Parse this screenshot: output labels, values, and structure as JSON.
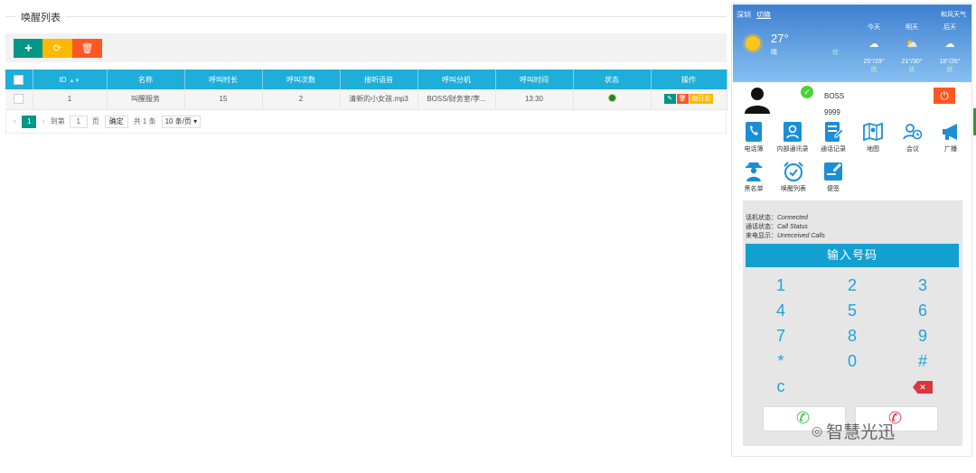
{
  "page": {
    "title": "唤醒列表"
  },
  "toolbar": {
    "add_icon": "+",
    "refresh_icon": "⟳",
    "delete_icon": "🗑"
  },
  "table": {
    "columns": [
      "ID",
      "名称",
      "呼叫时长",
      "呼叫次数",
      "接听语音",
      "呼叫分机",
      "呼叫时间",
      "状态",
      "操作"
    ],
    "rows": [
      {
        "id": "1",
        "name": "叫醒服务",
        "duration": "15",
        "count": "2",
        "voice": "清新的小女孩.mp3",
        "ext": "BOSS/财务室/李...",
        "time": "13:30",
        "status": "online",
        "log_label": "日志"
      }
    ]
  },
  "pager": {
    "current": "1",
    "goto_label": "到第",
    "goto_value": "1",
    "page_unit": "页",
    "confirm": "确定",
    "total": "共 1 条",
    "size": "10 条/页"
  },
  "weather": {
    "city": "深圳",
    "switch": "切换",
    "forecast_label": "和风天气",
    "temp": "27°",
    "cond": "晴",
    "aqi": "优",
    "days": [
      {
        "label": "今天",
        "range": "25°/29°",
        "aq": "优"
      },
      {
        "label": "明天",
        "range": "21°/30°",
        "aq": "优"
      },
      {
        "label": "后天",
        "range": "18°/26°",
        "aq": "优"
      }
    ]
  },
  "profile": {
    "name": "BOSS",
    "ext": "9999"
  },
  "apps": [
    {
      "label": "电话簿",
      "icon": "phonebook-icon"
    },
    {
      "label": "内部通讯录",
      "icon": "contacts-icon"
    },
    {
      "label": "通话记录",
      "icon": "call-log-icon"
    },
    {
      "label": "地图",
      "icon": "map-icon"
    },
    {
      "label": "会议",
      "icon": "meeting-icon"
    },
    {
      "label": "广播",
      "icon": "broadcast-icon"
    },
    {
      "label": "黑名单",
      "icon": "blacklist-icon"
    },
    {
      "label": "唤醒列表",
      "icon": "alarm-icon"
    },
    {
      "label": "便签",
      "icon": "note-icon"
    }
  ],
  "dialer": {
    "phone_state_label": "话机状态：",
    "phone_state": "Connected",
    "call_state_label": "通话状态：",
    "call_state": "Call Status",
    "incoming_label": "来电显示：",
    "incoming": "Unreceived Calls",
    "input_placeholder": "输入号码",
    "keys": [
      "1",
      "2",
      "3",
      "4",
      "5",
      "6",
      "7",
      "8",
      "9",
      "*",
      "0",
      "#"
    ],
    "clear": "c"
  },
  "watermark": "智慧光迅",
  "colors": {
    "primary": "#009688",
    "accent": "#1eaed9",
    "warn": "#ffb800",
    "danger": "#ff5722"
  }
}
